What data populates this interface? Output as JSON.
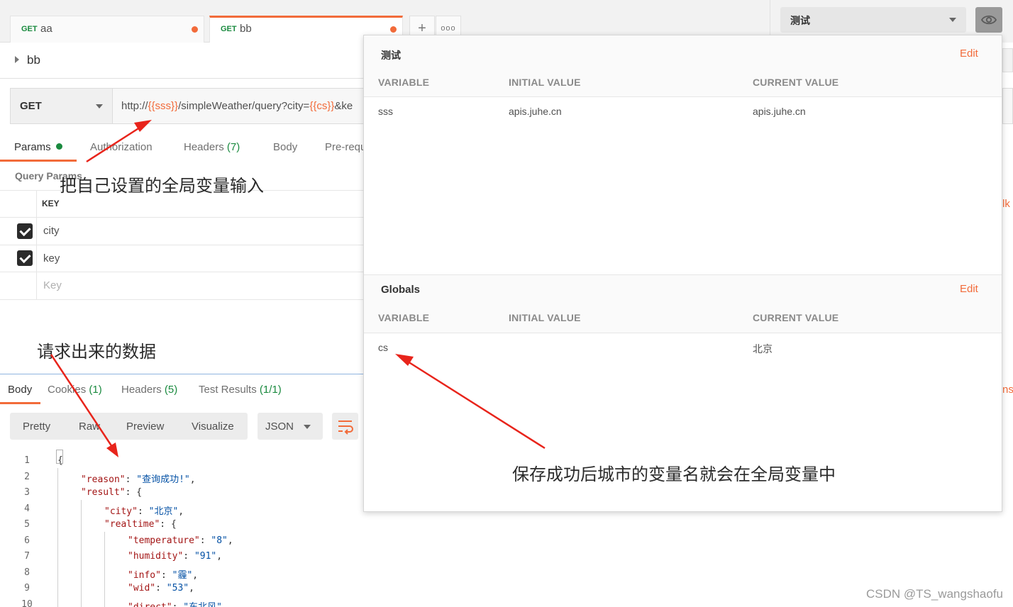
{
  "tabs": [
    {
      "method": "GET",
      "name": "aa"
    },
    {
      "method": "GET",
      "name": "bb"
    }
  ],
  "tab_actions": {
    "add": "+",
    "more": "ooo"
  },
  "environment": {
    "selected": "测试"
  },
  "request": {
    "name": "bb",
    "method": "GET",
    "url": {
      "prefix": "http://",
      "var1": "{{sss}}",
      "middle": "/simpleWeather/query?city=",
      "var2": "{{cs}}",
      "suffix": "&ke"
    }
  },
  "request_tabs": {
    "params": "Params",
    "authorization": "Authorization",
    "headers": "Headers",
    "headers_count": "(7)",
    "body": "Body",
    "prerequest": "Pre-requ"
  },
  "query_params": {
    "title": "Query Params",
    "key_header": "KEY",
    "rows": [
      "city",
      "key"
    ],
    "placeholder": "Key"
  },
  "response": {
    "tabs": {
      "body": "Body",
      "cookies": "Cookies",
      "cookies_count": "(1)",
      "headers": "Headers",
      "headers_count": "(5)",
      "tests": "Test Results",
      "tests_count": "(1/1)"
    },
    "view_buttons": [
      "Pretty",
      "Raw",
      "Preview",
      "Visualize"
    ],
    "format": "JSON",
    "code_lines": [
      {
        "n": "1",
        "indent": 0,
        "key": "",
        "value": "",
        "text": "{"
      },
      {
        "n": "2",
        "indent": 1,
        "key": "\"reason\"",
        "value": "\"查询成功!\"",
        "text": ","
      },
      {
        "n": "3",
        "indent": 1,
        "key": "\"result\"",
        "value": "",
        "text": "{"
      },
      {
        "n": "4",
        "indent": 2,
        "key": "\"city\"",
        "value": "\"北京\"",
        "text": ","
      },
      {
        "n": "5",
        "indent": 2,
        "key": "\"realtime\"",
        "value": "",
        "text": "{"
      },
      {
        "n": "6",
        "indent": 3,
        "key": "\"temperature\"",
        "value": "\"8\"",
        "text": ","
      },
      {
        "n": "7",
        "indent": 3,
        "key": "\"humidity\"",
        "value": "\"91\"",
        "text": ","
      },
      {
        "n": "8",
        "indent": 3,
        "key": "\"info\"",
        "value": "\"霾\"",
        "text": ","
      },
      {
        "n": "9",
        "indent": 3,
        "key": "\"wid\"",
        "value": "\"53\"",
        "text": ","
      },
      {
        "n": "10",
        "indent": 3,
        "key": "\"direct\"",
        "value": "\"东北风\"",
        "text": ","
      }
    ]
  },
  "popover": {
    "env": {
      "title": "测试",
      "edit": "Edit",
      "headers": [
        "VARIABLE",
        "INITIAL VALUE",
        "CURRENT VALUE"
      ],
      "rows": [
        {
          "variable": "sss",
          "initial": "apis.juhe.cn",
          "current": "apis.juhe.cn"
        }
      ]
    },
    "globals": {
      "title": "Globals",
      "edit": "Edit",
      "headers": [
        "VARIABLE",
        "INITIAL VALUE",
        "CURRENT VALUE"
      ],
      "rows": [
        {
          "variable": "cs",
          "initial": "",
          "current": "北京"
        }
      ]
    }
  },
  "right_clipped": {
    "bulk": "lk",
    "ns": "ns"
  },
  "annotations": {
    "a1": "把自己设置的全局变量输入",
    "a2": "请求出来的数据",
    "a3": "保存成功后城市的变量名就会在全局变量中"
  },
  "colors": {
    "accent": "#f26b3a",
    "green": "#1a8a3f",
    "arrow": "#e8241b"
  },
  "watermark": "CSDN @TS_wangshaofu"
}
